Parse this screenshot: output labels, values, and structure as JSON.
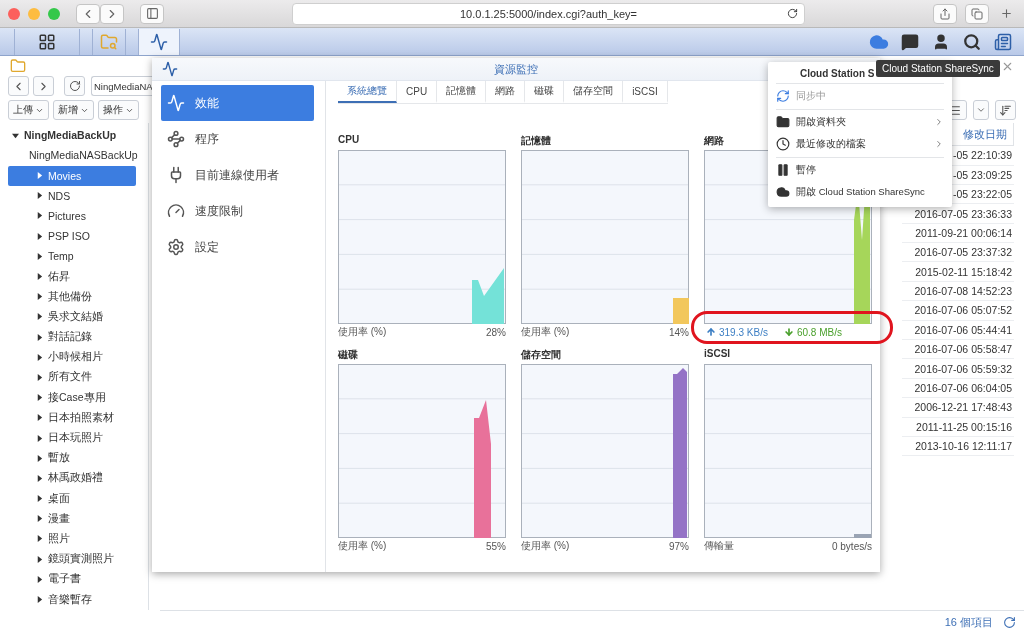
{
  "browser": {
    "url": "10.0.1.25:5000/index.cgi?auth_key="
  },
  "taskbar": {
    "apps": [
      {
        "kind": "home",
        "selected": false
      },
      {
        "kind": "files",
        "selected": false
      },
      {
        "kind": "monitor",
        "selected": true
      }
    ]
  },
  "file_station": {
    "path": "NingMediaNA",
    "actions": [
      "上傳",
      "新增",
      "操作"
    ],
    "tree": [
      {
        "label": "NingMediaBackUp",
        "expanded": true,
        "selected": false,
        "children": [
          {
            "label": "NingMediaNASBackUp",
            "expanded": true,
            "selected": false,
            "children": [
              {
                "label": "Movies",
                "expanded": false,
                "selected": true
              },
              {
                "label": "NDS",
                "expanded": false,
                "selected": false
              },
              {
                "label": "Pictures",
                "expanded": false,
                "selected": false
              },
              {
                "label": "PSP ISO",
                "expanded": false,
                "selected": false
              },
              {
                "label": "Temp",
                "expanded": false,
                "selected": false
              },
              {
                "label": "佑昇",
                "expanded": false,
                "selected": false
              },
              {
                "label": "其他備份",
                "expanded": false,
                "selected": false
              },
              {
                "label": "吳求文結婚",
                "expanded": false,
                "selected": false
              },
              {
                "label": "對話記錄",
                "expanded": false,
                "selected": false
              },
              {
                "label": "小時候相片",
                "expanded": false,
                "selected": false
              },
              {
                "label": "所有文件",
                "expanded": false,
                "selected": false
              },
              {
                "label": "接Case專用",
                "expanded": false,
                "selected": false
              },
              {
                "label": "日本拍照素材",
                "expanded": false,
                "selected": false
              },
              {
                "label": "日本玩照片",
                "expanded": false,
                "selected": false
              },
              {
                "label": "暫放",
                "expanded": false,
                "selected": false
              },
              {
                "label": "林禹政婚禮",
                "expanded": false,
                "selected": false
              },
              {
                "label": "桌面",
                "expanded": false,
                "selected": false
              },
              {
                "label": "漫畫",
                "expanded": false,
                "selected": false
              },
              {
                "label": "照片",
                "expanded": false,
                "selected": false
              },
              {
                "label": "鏡頭實測照片",
                "expanded": false,
                "selected": false
              },
              {
                "label": "電子書",
                "expanded": false,
                "selected": false
              },
              {
                "label": "音樂暫存",
                "expanded": false,
                "selected": false
              }
            ]
          }
        ]
      }
    ],
    "modified_column": {
      "header": "修改日期",
      "values": [
        "-05 22:10:39",
        "-05 23:09:25",
        "-05 23:22:05",
        "2016-07-05 23:36:33",
        "2011-09-21 00:06:14",
        "2016-07-05 23:37:32",
        "2015-02-11 15:18:42",
        "2016-07-08 14:52:23",
        "2016-07-06 05:07:52",
        "2016-07-06 05:44:41",
        "2016-07-06 05:58:47",
        "2016-07-06 05:59:32",
        "2016-07-06 06:04:05",
        "2006-12-21 17:48:43",
        "2011-11-25 00:15:16",
        "2013-10-16 12:11:17"
      ]
    },
    "item_count": "16 個項目"
  },
  "resource_monitor": {
    "title": "資源監控",
    "nav": [
      {
        "label": "效能",
        "selected": true
      },
      {
        "label": "程序",
        "selected": false
      },
      {
        "label": "目前連線使用者",
        "selected": false
      },
      {
        "label": "速度限制",
        "selected": false
      },
      {
        "label": "設定",
        "selected": false
      }
    ],
    "tabs": [
      {
        "label": "系統總覽",
        "selected": true
      },
      {
        "label": "CPU",
        "selected": false
      },
      {
        "label": "記憶體",
        "selected": false
      },
      {
        "label": "網路",
        "selected": false
      },
      {
        "label": "磁碟",
        "selected": false
      },
      {
        "label": "儲存空間",
        "selected": false
      },
      {
        "label": "iSCSI",
        "selected": false
      }
    ],
    "charts": [
      {
        "kind": "usage",
        "title": "CPU",
        "label": "使用率 (%)",
        "reading": "28%",
        "color": "#74e2d8"
      },
      {
        "kind": "usage",
        "title": "記憶體",
        "label": "使用率 (%)",
        "reading": "14%",
        "color": "#f2c75c"
      },
      {
        "kind": "network",
        "title": "網路",
        "upload": "319.3 KB/s",
        "download": "60.8 MB/s",
        "color": "#a6d65a"
      },
      {
        "kind": "usage",
        "title": "磁碟",
        "label": "使用率 (%)",
        "reading": "55%",
        "color": "#e8719a"
      },
      {
        "kind": "usage",
        "title": "儲存空間",
        "label": "使用率 (%)",
        "reading": "97%",
        "color": "#9473c6"
      },
      {
        "kind": "usage",
        "title": "iSCSI",
        "label": "傳輸量",
        "reading": "0 bytes/s",
        "color": "#9aa4b4"
      }
    ]
  },
  "sync_menu": {
    "title": "Cloud Station S",
    "sections": [
      {
        "items": [
          {
            "label": "同步中",
            "disabled": true,
            "submenu": false
          }
        ]
      },
      {
        "items": [
          {
            "label": "開啟資料夾",
            "disabled": false,
            "submenu": true
          },
          {
            "label": "最近修改的檔案",
            "disabled": false,
            "submenu": true
          }
        ]
      },
      {
        "items": [
          {
            "label": "暫停",
            "disabled": false,
            "submenu": false
          },
          {
            "label": "開啟 Cloud Station ShareSync",
            "disabled": false,
            "submenu": false
          }
        ]
      }
    ]
  },
  "tooltip": "Cloud Station ShareSync"
}
